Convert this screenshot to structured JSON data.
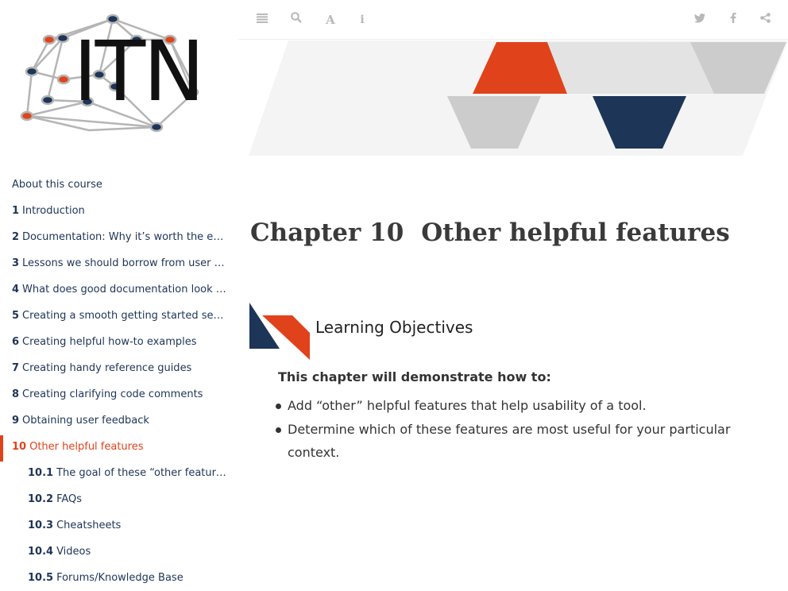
{
  "logo": {
    "text": "ITN"
  },
  "toolbar": {
    "left_icons": [
      "toc-toggle-icon",
      "search-icon",
      "font-settings-icon",
      "info-icon"
    ],
    "right_icons": [
      "twitter-icon",
      "facebook-icon",
      "share-icon"
    ]
  },
  "toc": {
    "items": [
      {
        "num": "",
        "label": "About this course"
      },
      {
        "num": "1",
        "label": "Introduction"
      },
      {
        "num": "2",
        "label": "Documentation: Why it’s worth the eff..."
      },
      {
        "num": "3",
        "label": "Lessons we should borrow from user d..."
      },
      {
        "num": "4",
        "label": "What does good documentation look l..."
      },
      {
        "num": "5",
        "label": "Creating a smooth getting started sect..."
      },
      {
        "num": "6",
        "label": "Creating helpful how-to examples"
      },
      {
        "num": "7",
        "label": "Creating handy reference guides"
      },
      {
        "num": "8",
        "label": "Creating clarifying code comments"
      },
      {
        "num": "9",
        "label": "Obtaining user feedback"
      },
      {
        "num": "10",
        "label": "Other helpful features"
      },
      {
        "num": "10.1",
        "label": "The goal of these “other features”"
      },
      {
        "num": "10.2",
        "label": "FAQs"
      },
      {
        "num": "10.3",
        "label": "Cheatsheets"
      },
      {
        "num": "10.4",
        "label": "Videos"
      },
      {
        "num": "10.5",
        "label": "Forums/Knowledge Base"
      }
    ]
  },
  "chapter": {
    "number": "Chapter 10",
    "title": "Other helpful features"
  },
  "objectives": {
    "heading": "Learning Objectives",
    "intro": "This chapter will demonstrate how to:",
    "items": [
      "Add “other” helpful features that help usability of a tool.",
      "Determine which of these features are most useful for your particular context."
    ]
  },
  "colors": {
    "accent_orange": "#e0431b",
    "accent_navy": "#1d3557",
    "banner_gray": "#cccccc",
    "banner_light": "#f4f4f4"
  }
}
